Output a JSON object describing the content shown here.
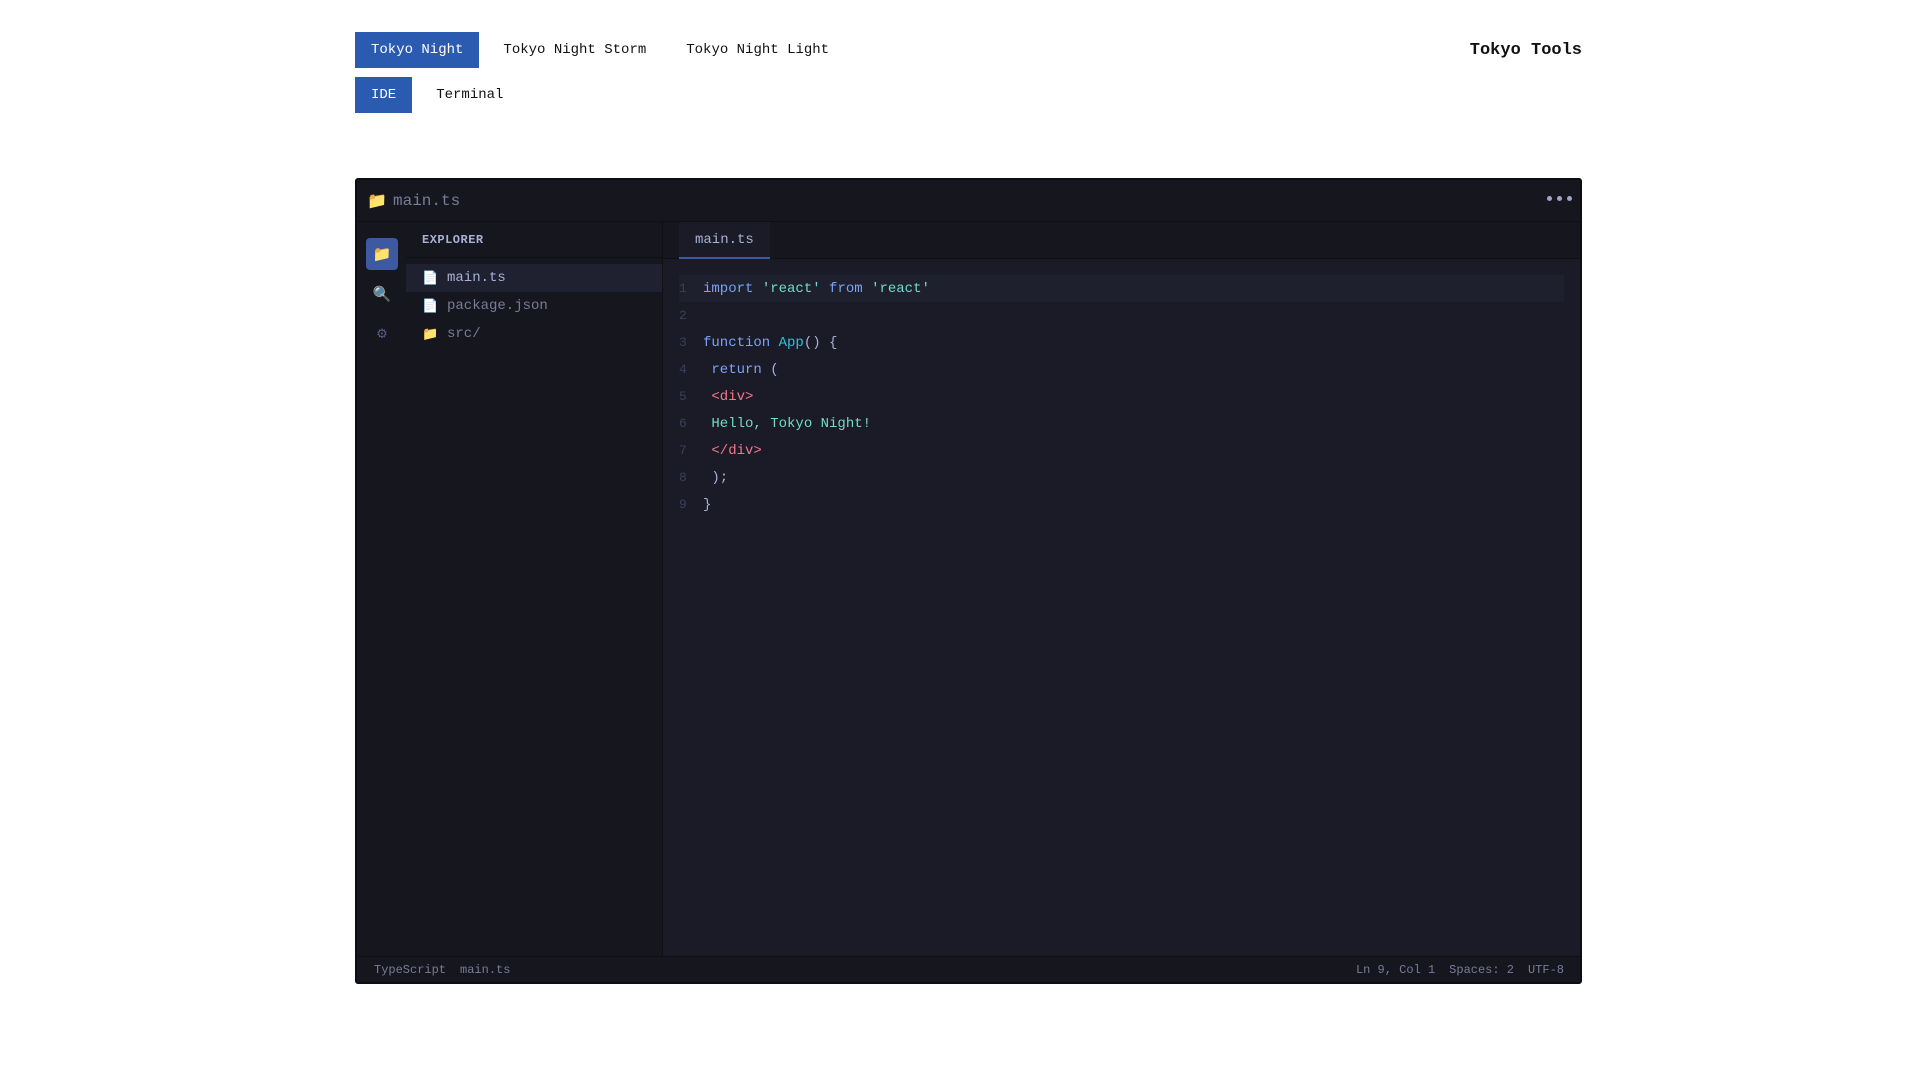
{
  "theme_toggles": [
    {
      "label": "Tokyo Night",
      "active": true
    },
    {
      "label": "Tokyo Night Storm",
      "active": false
    },
    {
      "label": "Tokyo Night Light",
      "active": false
    }
  ],
  "mode_toggles": [
    {
      "label": "IDE",
      "active": true
    },
    {
      "label": "Terminal",
      "active": false
    }
  ],
  "brand": "Tokyo Tools",
  "window": {
    "title": "main.ts",
    "title_icon": "folder-icon",
    "menu_icon": "more-dots-icon"
  },
  "activity_bar": [
    {
      "icon": "folder-icon",
      "glyph": "📁",
      "active": true
    },
    {
      "icon": "search-icon",
      "glyph": "🔍",
      "active": false
    },
    {
      "icon": "settings-icon",
      "glyph": "⚙",
      "active": false
    }
  ],
  "sidebar": {
    "header": "EXPLORER",
    "files": [
      {
        "name": "main.ts",
        "icon": "file-icon",
        "glyph": "📄",
        "active": true
      },
      {
        "name": "package.json",
        "icon": "file-icon",
        "glyph": "📄",
        "active": false
      },
      {
        "name": "src/",
        "icon": "folder-icon",
        "glyph": "📁",
        "active": false
      }
    ]
  },
  "editor": {
    "tab": "main.ts",
    "lines": [
      {
        "n": "1",
        "tokens": [
          [
            "kw",
            "import"
          ],
          [
            "punc",
            " "
          ],
          [
            "str",
            "'react'"
          ],
          [
            "punc",
            " "
          ],
          [
            "kw",
            "from"
          ],
          [
            "punc",
            " "
          ],
          [
            "str",
            "'react'"
          ]
        ]
      },
      {
        "n": "2",
        "tokens": []
      },
      {
        "n": "3",
        "tokens": [
          [
            "kw",
            "function"
          ],
          [
            "punc",
            " "
          ],
          [
            "fn",
            "App"
          ],
          [
            "punc",
            "() {"
          ]
        ]
      },
      {
        "n": "4",
        "tokens": [
          [
            "punc",
            " "
          ],
          [
            "kw",
            "return"
          ],
          [
            "punc",
            " ("
          ]
        ]
      },
      {
        "n": "5",
        "tokens": [
          [
            "punc",
            " "
          ],
          [
            "tag",
            "<div>"
          ]
        ]
      },
      {
        "n": "6",
        "tokens": [
          [
            "punc",
            " "
          ],
          [
            "text",
            "Hello, Tokyo Night!"
          ]
        ]
      },
      {
        "n": "7",
        "tokens": [
          [
            "punc",
            " "
          ],
          [
            "tag",
            "</div>"
          ]
        ]
      },
      {
        "n": "8",
        "tokens": [
          [
            "punc",
            " );"
          ]
        ]
      },
      {
        "n": "9",
        "tokens": [
          [
            "punc",
            "}"
          ]
        ]
      }
    ]
  },
  "statusbar": {
    "left": [
      "TypeScript",
      "main.ts"
    ],
    "right": [
      "Ln 9, Col 1",
      "Spaces: 2",
      "UTF-8"
    ]
  },
  "colors": {
    "accent": "#2b5ab1",
    "editor_bg": "#1a1b26",
    "keyword": "#7aa2f7",
    "string": "#73daca",
    "function": "#2ac3de",
    "tag": "#f7768e"
  }
}
